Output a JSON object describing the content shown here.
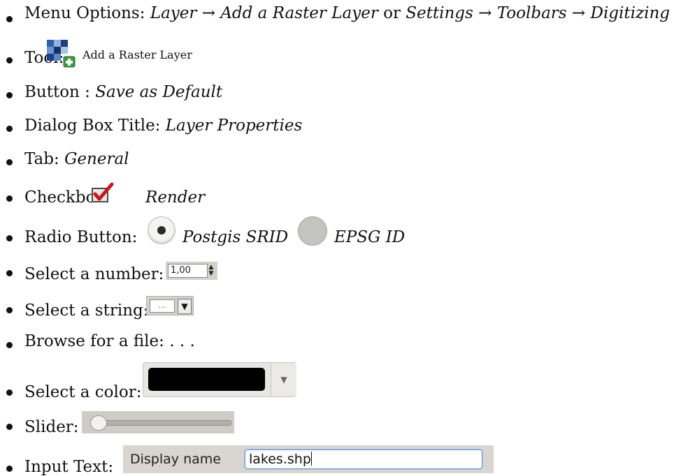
{
  "items": {
    "menu": {
      "label": "Menu Options:",
      "path1_a": "Layer",
      "arrow": "→",
      "path1_b": "Add a Raster Layer",
      "or": "or",
      "path2_a": "Settings",
      "path2_b": "Toolbars",
      "path2_c": "Digitizing"
    },
    "tool": {
      "label": "Tool:",
      "icon": "add-raster-layer-icon",
      "caption": "Add a Raster Layer"
    },
    "button": {
      "label": "Button :",
      "value": "Save as Default"
    },
    "dialog": {
      "label": "Dialog Box Title:",
      "value": "Layer Properties"
    },
    "tab": {
      "label": "Tab:",
      "value": "General"
    },
    "checkbox": {
      "label": "Checkbox:",
      "value": "Render",
      "checked": true
    },
    "radio": {
      "label": "Radio Button:",
      "option1": "Postgis SRID",
      "option2": "EPSG ID",
      "selected": "Postgis SRID"
    },
    "number": {
      "label": "Select a number:",
      "value": "1,00"
    },
    "string": {
      "label": "Select a string:",
      "value": "..."
    },
    "browse": {
      "label": "Browse for a file:",
      "value": ". . ."
    },
    "color": {
      "label": "Select a color:",
      "swatch": "#000000"
    },
    "slider": {
      "label": "Slider:",
      "level": 0
    },
    "input": {
      "label": "Input Text:",
      "field_label": "Display name",
      "field_value": "lakes.shp"
    }
  }
}
